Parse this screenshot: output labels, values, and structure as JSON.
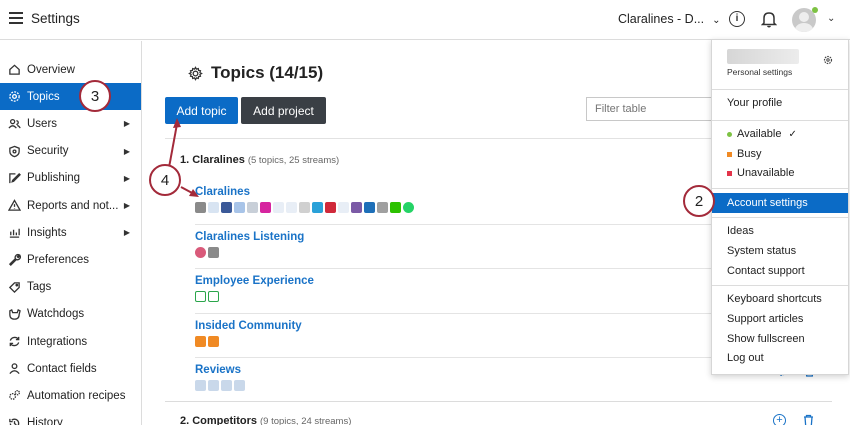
{
  "topbar": {
    "title": "Settings",
    "account": "Claralines - D...",
    "account_chevron": "⌄",
    "avatar_chevron": "⌄"
  },
  "sidebar": {
    "items": [
      {
        "label": "Overview",
        "icon": "home-icon",
        "arrow": false,
        "active": false
      },
      {
        "label": "Topics",
        "icon": "gear-icon",
        "arrow": false,
        "active": true
      },
      {
        "label": "Users",
        "icon": "users-icon",
        "arrow": true,
        "active": false
      },
      {
        "label": "Security",
        "icon": "shield-icon",
        "arrow": true,
        "active": false
      },
      {
        "label": "Publishing",
        "icon": "edit-icon",
        "arrow": true,
        "active": false
      },
      {
        "label": "Reports and not...",
        "icon": "warning-icon",
        "arrow": true,
        "active": false
      },
      {
        "label": "Insights",
        "icon": "insights-icon",
        "arrow": true,
        "active": false
      },
      {
        "label": "Preferences",
        "icon": "wrench-icon",
        "arrow": false,
        "active": false
      },
      {
        "label": "Tags",
        "icon": "tag-icon",
        "arrow": false,
        "active": false
      },
      {
        "label": "Watchdogs",
        "icon": "watchdog-icon",
        "arrow": false,
        "active": false
      },
      {
        "label": "Integrations",
        "icon": "sync-icon",
        "arrow": false,
        "active": false
      },
      {
        "label": "Contact fields",
        "icon": "person-icon",
        "arrow": false,
        "active": false
      },
      {
        "label": "Automation recipes",
        "icon": "gears-icon",
        "arrow": false,
        "active": false
      },
      {
        "label": "History",
        "icon": "history-icon",
        "arrow": false,
        "active": false
      }
    ]
  },
  "main": {
    "title": "Topics (14/15)",
    "add_topic": "Add topic",
    "add_project": "Add project",
    "filter_placeholder": "Filter table",
    "projects": [
      {
        "name": "1. Claralines",
        "meta": "(5 topics, 25 streams)"
      },
      {
        "name": "2. Competitors",
        "meta": "(9 topics, 24 streams)"
      }
    ],
    "topics": [
      {
        "name": "Claralines"
      },
      {
        "name": "Claralines Listening"
      },
      {
        "name": "Employee Experience"
      },
      {
        "name": "Insided Community"
      },
      {
        "name": "Reviews"
      }
    ]
  },
  "menu": {
    "personal_settings": "Personal settings",
    "your_profile": "Your profile",
    "status": [
      {
        "label": "Available",
        "color": "#7dc243",
        "checked": true
      },
      {
        "label": "Busy",
        "color": "#f08a24",
        "checked": false
      },
      {
        "label": "Unavailable",
        "color": "#e3344a",
        "checked": false
      }
    ],
    "check_mark": "✓",
    "account_settings": "Account settings",
    "group2": [
      "Ideas",
      "System status",
      "Contact support"
    ],
    "group3": [
      "Keyboard shortcuts",
      "Support articles",
      "Show fullscreen",
      "Log out"
    ]
  },
  "annotations": {
    "c2": "2",
    "c3": "3",
    "c4": "4"
  },
  "colors": {
    "accent": "#0b6bc6",
    "link": "#1a73c7",
    "callout_border": "#a32a3a"
  }
}
